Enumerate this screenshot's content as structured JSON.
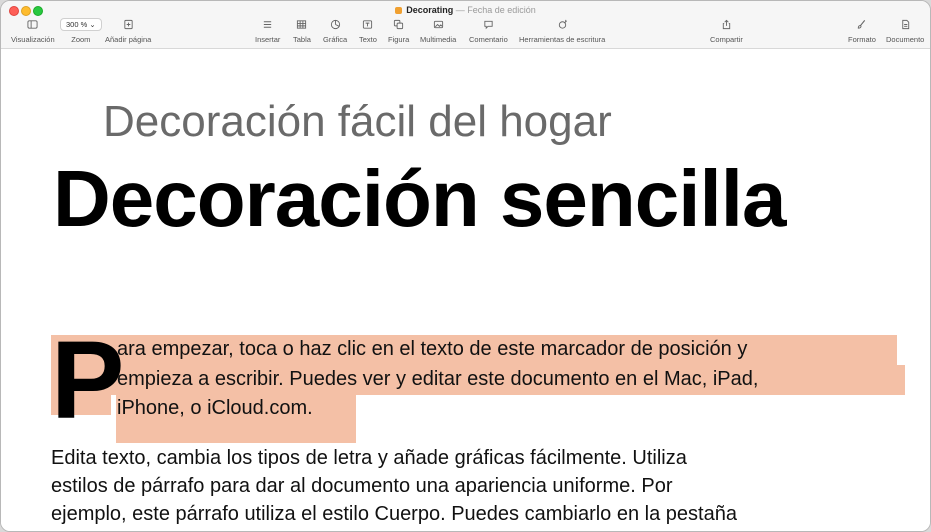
{
  "window": {
    "doc_name": "Decorating",
    "separator": "—",
    "edit_state": "Fecha de edición"
  },
  "toolbar": {
    "view_label": "Visualización",
    "zoom_value": "300 %",
    "zoom_label": "Zoom",
    "add_page_label": "Añadir página",
    "insert_label": "Insertar",
    "table_label": "Tabla",
    "chart_label": "Gráfica",
    "text_label": "Texto",
    "shape_label": "Figura",
    "media_label": "Multimedia",
    "comment_label": "Comentario",
    "writing_tools_label": "Herramientas de escritura",
    "share_label": "Compartir",
    "format_label": "Formato",
    "document_label": "Documento"
  },
  "document": {
    "subtitle": "Decoración fácil del hogar",
    "title": "Decoración sencilla",
    "drop_cap": "P",
    "para1": [
      "ara empezar, toca o haz clic en el texto de este marcador de posición y",
      "empieza a escribir. Puedes ver y editar este documento en el Mac, iPad,",
      "iPhone, o iCloud.com."
    ],
    "para2": [
      "Edita texto, cambia los tipos de letra y añade gráficas fácilmente. Utiliza",
      "estilos de párrafo para dar al documento una apariencia uniforme. Por",
      "ejemplo, este párrafo utiliza el estilo Cuerpo. Puedes cambiarlo en la pestaña"
    ]
  },
  "colors": {
    "selection": "#f4c0a6",
    "subtitle": "#6a6a6a"
  }
}
